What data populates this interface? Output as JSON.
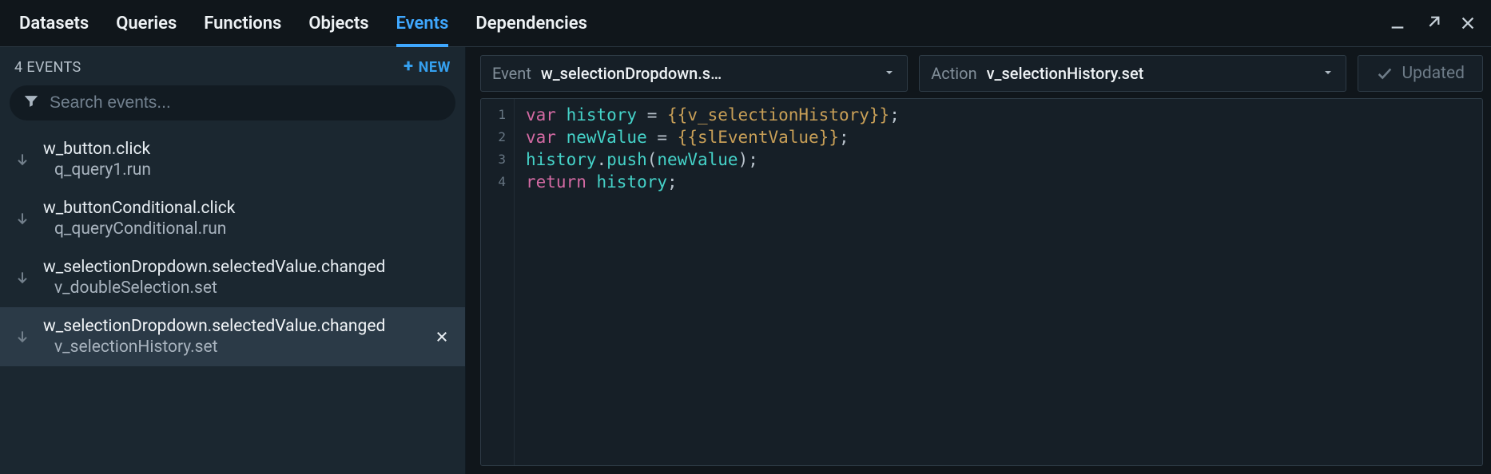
{
  "tabs": {
    "items": [
      "Datasets",
      "Queries",
      "Functions",
      "Objects",
      "Events",
      "Dependencies"
    ],
    "activeIndex": 4
  },
  "sidebar": {
    "count_label": "4 EVENTS",
    "new_label": "NEW",
    "search_placeholder": "Search events...",
    "items": [
      {
        "trigger": "w_button.click",
        "action": "q_query1.run",
        "selected": false
      },
      {
        "trigger": "w_buttonConditional.click",
        "action": "q_queryConditional.run",
        "selected": false
      },
      {
        "trigger": "w_selectionDropdown.selectedValue.changed",
        "action": "v_doubleSelection.set",
        "selected": false
      },
      {
        "trigger": "w_selectionDropdown.selectedValue.changed",
        "action": "v_selectionHistory.set",
        "selected": true
      }
    ]
  },
  "editor": {
    "event_label": "Event",
    "event_value": "w_selectionDropdown.s…",
    "action_label": "Action",
    "action_value": "v_selectionHistory.set",
    "status_label": "Updated",
    "code_lines": [
      {
        "ln": 1,
        "tokens": [
          {
            "t": "var ",
            "c": "kw"
          },
          {
            "t": "history",
            "c": "id1"
          },
          {
            "t": " = ",
            "c": "punc"
          },
          {
            "t": "{{v_selectionHistory}}",
            "c": "tmpl"
          },
          {
            "t": ";",
            "c": "punc"
          }
        ]
      },
      {
        "ln": 2,
        "tokens": [
          {
            "t": "var ",
            "c": "kw"
          },
          {
            "t": "newValue",
            "c": "id1"
          },
          {
            "t": " = ",
            "c": "punc"
          },
          {
            "t": "{{slEventValue}}",
            "c": "tmpl"
          },
          {
            "t": ";",
            "c": "punc"
          }
        ]
      },
      {
        "ln": 3,
        "tokens": [
          {
            "t": "history",
            "c": "id1"
          },
          {
            "t": ".",
            "c": "punc"
          },
          {
            "t": "push",
            "c": "fn"
          },
          {
            "t": "(",
            "c": "punc"
          },
          {
            "t": "newValue",
            "c": "id1"
          },
          {
            "t": ")",
            "c": "punc"
          },
          {
            "t": ";",
            "c": "punc"
          }
        ]
      },
      {
        "ln": 4,
        "tokens": [
          {
            "t": "return ",
            "c": "kw"
          },
          {
            "t": "history",
            "c": "id1"
          },
          {
            "t": ";",
            "c": "punc"
          }
        ]
      }
    ]
  }
}
